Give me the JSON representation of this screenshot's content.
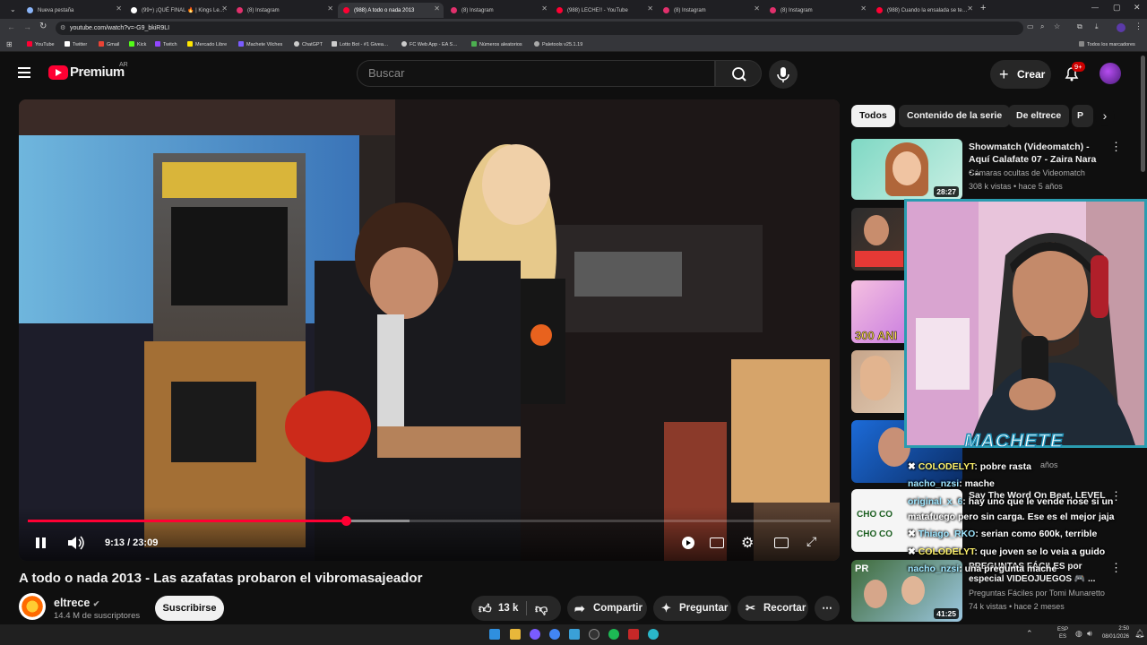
{
  "browser": {
    "tabs": [
      {
        "label": "Nueva pestaña",
        "fav": "#8ab4f8"
      },
      {
        "label": "(99+) ¡QUÉ FINAL 🔥 | Kings Le…",
        "fav": "#ffffff"
      },
      {
        "label": "(8) Instagram",
        "fav": "#e1306c"
      },
      {
        "label": "(988) A todo o nada 2013",
        "fav": "#ff0033"
      },
      {
        "label": "(8) Instagram",
        "fav": "#e1306c"
      },
      {
        "label": "(988) LECHE!! - YouTube",
        "fav": "#ff0033"
      },
      {
        "label": "(8) Instagram",
        "fav": "#e1306c"
      },
      {
        "label": "(8) Instagram",
        "fav": "#e1306c"
      },
      {
        "label": "(988) Cuando la ensalada se te…",
        "fav": "#ff0033"
      }
    ],
    "url": "youtube.com/watch?v=-G9_bkiR9LI",
    "bookmarks": [
      {
        "label": "YouTube",
        "color": "#ff0033"
      },
      {
        "label": "Twitter",
        "color": "#ffffff"
      },
      {
        "label": "Gmail",
        "color": "#ea4335"
      },
      {
        "label": "Kick",
        "color": "#53fc18"
      },
      {
        "label": "Twitch",
        "color": "#9146ff"
      },
      {
        "label": "Mercado Libre",
        "color": "#ffe600"
      },
      {
        "label": "Machete Vilches",
        "color": "#7a5cff"
      },
      {
        "label": "ChatGPT",
        "color": "#cccccc"
      },
      {
        "label": "Lotto Bot - #1 Givea…",
        "color": "#cccccc"
      },
      {
        "label": "FC Web App - EA S…",
        "color": "#cccccc"
      },
      {
        "label": "Números aleatorios",
        "color": "#4caf50"
      },
      {
        "label": "Paletools v25.1.19",
        "color": "#aaaaaa"
      }
    ],
    "all_bookmarks": "Todos los marcadores"
  },
  "header": {
    "logo_text": "Premium",
    "region": "AR",
    "search_placeholder": "Buscar",
    "create_label": "Crear",
    "notif_badge": "9+"
  },
  "player": {
    "time": "9:13 / 23:09",
    "progress": 0.396,
    "buffered": 0.476
  },
  "video": {
    "title": "A todo o nada 2013 - Las azafatas probaron el vibromasajeador",
    "channel": "eltrece",
    "subscribers": "14.4 M de suscriptores",
    "subscribe_label": "Suscribirse",
    "likes": "13 k",
    "share_label": "Compartir",
    "ask_label": "Preguntar",
    "clip_label": "Recortar"
  },
  "chips": [
    "Todos",
    "Contenido de la serie",
    "De eltrece",
    "P"
  ],
  "related": [
    {
      "title": "Showmatch (Videomatch) - Aquí Calafate 07 - Zaira Nara -…",
      "channel": "Cámaras ocultas de Videomatch",
      "meta": "308 k vistas • hace 5 años",
      "duration": "28:27"
    },
    {
      "title": "",
      "channel": "",
      "meta": "",
      "duration": ""
    },
    {
      "title": "",
      "channel": "",
      "meta": "",
      "duration": ""
    },
    {
      "title": "",
      "channel": "",
      "meta": "",
      "duration": ""
    },
    {
      "title": "",
      "channel": "",
      "meta": "años",
      "duration": ""
    },
    {
      "title": "Say The Word On Beat, LEVEL",
      "channel": "",
      "meta": "",
      "duration": ""
    },
    {
      "title": "PREGUNTAS FÁCILES por especial VIDEOJUEGOS 🎮 ...",
      "channel": "Preguntas Fáciles por Tomi Munaretto",
      "meta": "74 k vistas • hace 2 meses",
      "duration": "41:25"
    }
  ],
  "overlay": {
    "streamer_name": "MACHETE",
    "chat": [
      {
        "user": "COLODELYT",
        "msg": ": pobre rasta"
      },
      {
        "user": "nacho_nzsi",
        "msg": ": mache"
      },
      {
        "user": "original_x_6",
        "msg": ": hay uno que le vende nose si un"
      },
      {
        "user": "",
        "msg": "matafuego pero sin carga. Ese es el mejor jaja"
      },
      {
        "user": "Thiago_RKO",
        "msg": ": serian como 600k, terrible"
      },
      {
        "user": "COLODELYT",
        "msg": ": que joven se lo veia a guido"
      },
      {
        "user": "nacho_nzsi",
        "msg": ": una pregunta mache"
      }
    ]
  },
  "taskbar": {
    "lang": "ESP",
    "lang2": "ES",
    "time": "2:50",
    "date": "08/01/2026"
  }
}
